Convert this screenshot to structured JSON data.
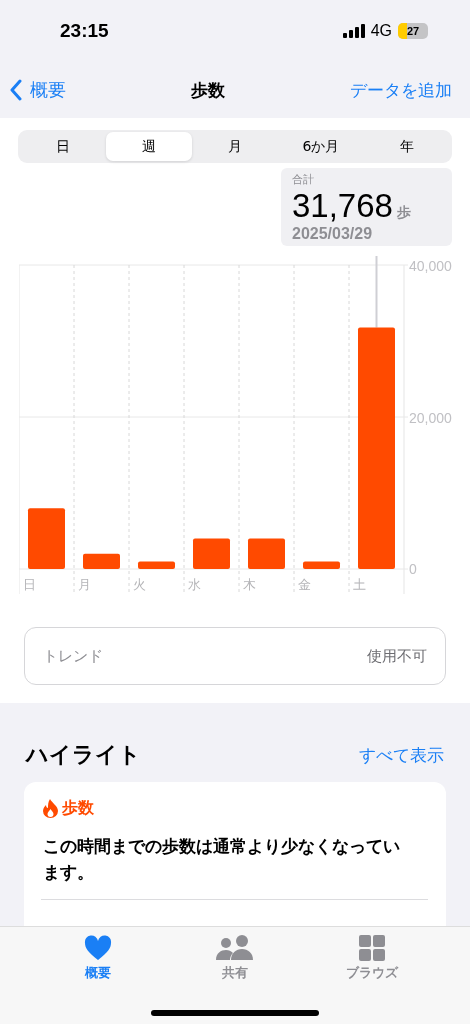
{
  "status_bar": {
    "time": "23:15",
    "network": "4G",
    "battery": "27"
  },
  "nav": {
    "back": "概要",
    "title": "歩数",
    "action": "データを追加"
  },
  "segments": [
    {
      "label": "日",
      "selected": false
    },
    {
      "label": "週",
      "selected": true
    },
    {
      "label": "月",
      "selected": false
    },
    {
      "label": "6か月",
      "selected": false
    },
    {
      "label": "年",
      "selected": false
    }
  ],
  "selection": {
    "label": "合計",
    "value": "31,768",
    "unit": "歩",
    "date": "2025/03/29"
  },
  "chart_data": {
    "type": "bar",
    "categories": [
      "日",
      "月",
      "火",
      "水",
      "木",
      "金",
      "土"
    ],
    "series": [
      {
        "color": "#ff4a00",
        "values": [
          8000,
          2000,
          1000,
          4000,
          4000,
          1000,
          31768
        ]
      }
    ],
    "ylim": [
      0,
      40000
    ],
    "yticks": [
      {
        "value": 0,
        "label": "0"
      },
      {
        "value": 20000,
        "label": "20,000"
      },
      {
        "value": 40000,
        "label": "40,000"
      }
    ]
  },
  "trend": {
    "label": "トレンド",
    "value": "使用不可"
  },
  "highlights": {
    "title": "ハイライト",
    "link": "すべて表示",
    "card": {
      "metric": "歩数",
      "text": "この時間までの歩数は通常より少なくなっています。"
    }
  },
  "tab_bar": [
    {
      "label": "概要",
      "kind": "heart",
      "selected": true
    },
    {
      "label": "共有",
      "kind": "people",
      "selected": false
    },
    {
      "label": "ブラウズ",
      "kind": "grid",
      "selected": false
    }
  ]
}
